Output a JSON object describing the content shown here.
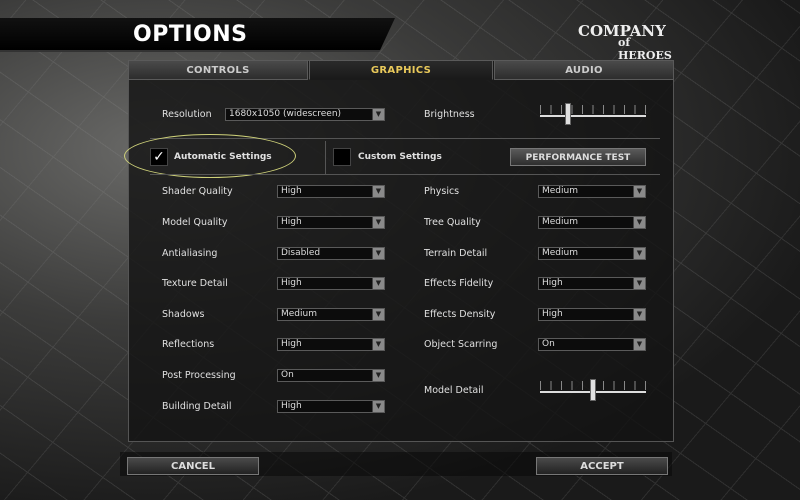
{
  "header": {
    "title": "OPTIONS"
  },
  "logo": {
    "line1": "COMPANY",
    "line2": "of HEROES"
  },
  "tabs": [
    "CONTROLS",
    "GRAPHICS",
    "AUDIO"
  ],
  "active_tab": "GRAPHICS",
  "resolution": {
    "label": "Resolution",
    "value": "1680x1050 (widescreen)"
  },
  "brightness": {
    "label": "Brightness",
    "level": 0.25
  },
  "automatic": {
    "label": "Automatic Settings",
    "checked": true,
    "check_glyph": "✓"
  },
  "custom": {
    "label": "Custom Settings",
    "checked": false
  },
  "performance_test": "PERFORMANCE TEST",
  "left_settings": [
    {
      "label": "Shader Quality",
      "value": "High"
    },
    {
      "label": "Model Quality",
      "value": "High"
    },
    {
      "label": "Antialiasing",
      "value": "Disabled"
    },
    {
      "label": "Texture Detail",
      "value": "High"
    },
    {
      "label": "Shadows",
      "value": "Medium"
    },
    {
      "label": "Reflections",
      "value": "High"
    },
    {
      "label": "Post Processing",
      "value": "On"
    },
    {
      "label": "Building Detail",
      "value": "High"
    }
  ],
  "right_settings": [
    {
      "label": "Physics",
      "value": "Medium"
    },
    {
      "label": "Tree Quality",
      "value": "Medium"
    },
    {
      "label": "Terrain Detail",
      "value": "Medium"
    },
    {
      "label": "Effects Fidelity",
      "value": "High"
    },
    {
      "label": "Effects Density",
      "value": "High"
    },
    {
      "label": "Object Scarring",
      "value": "On"
    }
  ],
  "model_detail": {
    "label": "Model Detail",
    "level": 0.5
  },
  "footer": {
    "cancel": "CANCEL",
    "accept": "ACCEPT"
  },
  "icons": {
    "dropdown_arrow": "▼"
  }
}
